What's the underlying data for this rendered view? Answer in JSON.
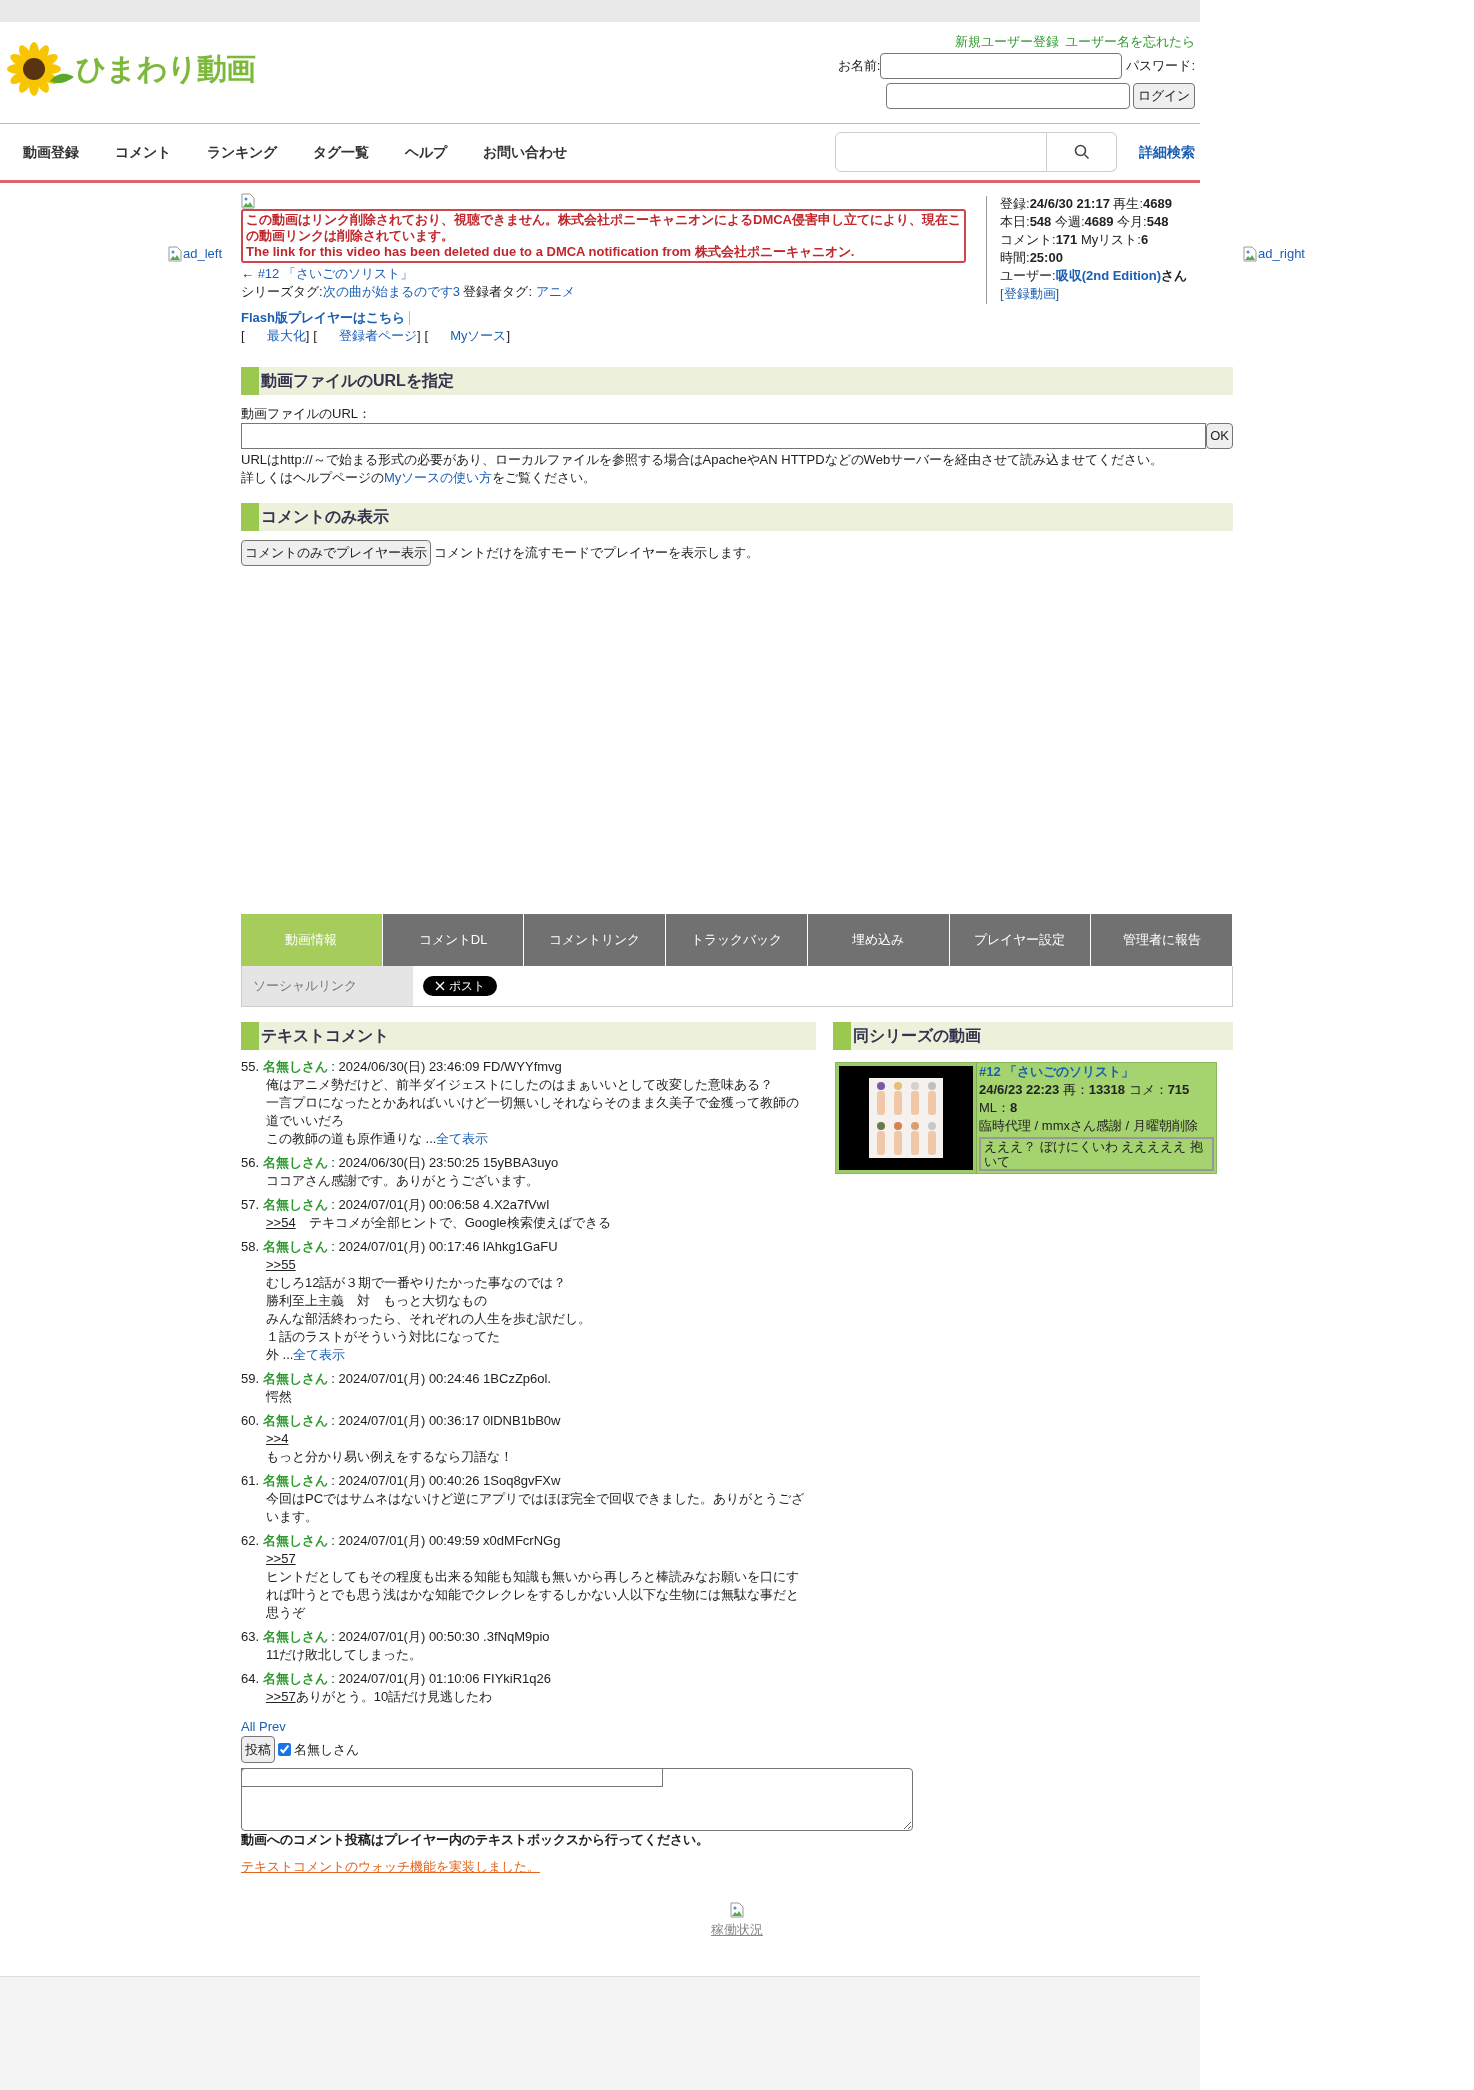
{
  "header": {
    "logo_text": "ひまわり動画",
    "account_links": [
      "新規ユーザー登録",
      "ユーザー名を忘れたら"
    ],
    "name_label": "お名前:",
    "password_label": "パスワード:",
    "login_button": "ログイン"
  },
  "nav": {
    "items": [
      "動画登録",
      "コメント",
      "ランキング",
      "タグ一覧",
      "ヘルプ",
      "お問い合わせ"
    ],
    "advanced_search": "詳細検索"
  },
  "ads": {
    "left": "ad_left",
    "right": "ad_right"
  },
  "notice": {
    "message_ja": "この動画はリンク削除されており、視聴できません。株式会社ポニーキャニオンによるDMCA侵害申し立てにより、現在この動画リンクは削除されています。",
    "message_en": "The link for this video has been deleted due to a DMCA notification from 株式会社ポニーキャニオン."
  },
  "prev_episode": {
    "arrow": "←",
    "title": "#12 「さいごのソリスト」"
  },
  "tags": {
    "series_label": "シリーズタグ:",
    "series_tag": "次の曲が始まるのです3",
    "user_label": "登録者タグ:",
    "user_tag": "アニメ"
  },
  "flash_link": "Flash版プレイヤーはこちら",
  "player_links": {
    "open": "[",
    "close": "]",
    "items": [
      "最大化",
      "登録者ページ",
      "Myソース"
    ]
  },
  "stats": {
    "lines": [
      "登録:**24/6/30 21:17** 再生:**4689**",
      "本日:**548** 今週:**4689** 今月:**548**",
      "コメント:**171** Myリスト:**6**",
      "時間:**25:00**"
    ],
    "user_label": "ユーザー:",
    "user_name": "吸収(2nd Edition)",
    "user_suffix": "さん",
    "user_link_open": "[",
    "user_link": "登録動画",
    "user_link_close": "]"
  },
  "url_section": {
    "title": "動画ファイルのURLを指定",
    "field_label": "動画ファイルのURL：",
    "ok_button": "OK",
    "help_line": "URLはhttp://～で始まる形式の必要があり、ローカルファイルを参照する場合はApacheやAN HTTPDなどのWebサーバーを経由させて読み込ませてください。",
    "help_prefix": "詳しくはヘルプページの",
    "help_link": "Myソースの使い方",
    "help_suffix": "をご覧ください。"
  },
  "comment_only_section": {
    "title": "コメントのみ表示",
    "button": "コメントのみでプレイヤー表示",
    "description": "コメントだけを流すモードでプレイヤーを表示します。"
  },
  "tabs": [
    {
      "label": "動画情報",
      "selected": true
    },
    {
      "label": "コメントDL",
      "selected": false
    },
    {
      "label": "コメントリンク",
      "selected": false
    },
    {
      "label": "トラックバック",
      "selected": false
    },
    {
      "label": "埋め込み",
      "selected": false
    },
    {
      "label": "プレイヤー設定",
      "selected": false
    },
    {
      "label": "管理者に報告",
      "selected": false
    }
  ],
  "social": {
    "label": "ソーシャルリンク",
    "post_button": "ポスト"
  },
  "text_comments": {
    "title": "テキストコメント",
    "items": [
      {
        "number": "55.",
        "name": "名無しさん",
        "meta": ": 2024/06/30(日) 23:46:09 FD/WYYfmvg",
        "lines": [
          {
            "text": "俺はアニメ勢だけど、前半ダイジェストにしたのはまぁいいとして改変した意味ある？"
          },
          {
            "text": "一言プロになったとかあればいいけど一切無いしそれならそのまま久美子で金獲って教師の道でいいだろ"
          },
          {
            "text": "この教師の道も原作通りな ...",
            "more": "全て表示"
          }
        ]
      },
      {
        "number": "56.",
        "name": "名無しさん",
        "meta": ": 2024/06/30(日) 23:50:25 15yBBA3uyo",
        "lines": [
          {
            "text": "ココアさん感謝です。ありがとうございます。"
          }
        ]
      },
      {
        "number": "57.",
        "name": "名無しさん",
        "meta": ": 2024/07/01(月) 00:06:58 4.X2a7fVwI",
        "lines": [
          {
            "reply": ">>54",
            "text": "　テキコメが全部ヒントで、Google検索使えばできる"
          }
        ]
      },
      {
        "number": "58.",
        "name": "名無しさん",
        "meta": ": 2024/07/01(月) 00:17:46 lAhkg1GaFU",
        "lines": [
          {
            "reply": ">>55"
          },
          {
            "text": "むしろ12話が３期で一番やりたかった事なのでは？"
          },
          {
            "text": "勝利至上主義　対　もっと大切なもの"
          },
          {
            "text": "みんな部活終わったら、それぞれの人生を歩む訳だし。"
          },
          {
            "text": "１話のラストがそういう対比になってた"
          },
          {
            "text": "外 ...",
            "more": "全て表示"
          }
        ]
      },
      {
        "number": "59.",
        "name": "名無しさん",
        "meta": ": 2024/07/01(月) 00:24:46 1BCzZp6ol.",
        "lines": [
          {
            "text": "愕然"
          }
        ]
      },
      {
        "number": "60.",
        "name": "名無しさん",
        "meta": ": 2024/07/01(月) 00:36:17 0lDNB1bB0w",
        "lines": [
          {
            "reply": ">>4"
          },
          {
            "text": "もっと分かり易い例えをするなら刀語な！"
          }
        ]
      },
      {
        "number": "61.",
        "name": "名無しさん",
        "meta": ": 2024/07/01(月) 00:40:26 1Soq8gvFXw",
        "lines": [
          {
            "text": "今回はPCではサムネはないけど逆にアプリではほぼ完全で回収できました。ありがとうございます。"
          }
        ]
      },
      {
        "number": "62.",
        "name": "名無しさん",
        "meta": ": 2024/07/01(月) 00:49:59 x0dMFcrNGg",
        "lines": [
          {
            "reply": ">>57"
          },
          {
            "text": "ヒントだとしてもその程度も出来る知能も知識も無いから再しろと棒読みなお願いを口にすれば叶うとでも思う浅はかな知能でクレクレをするしかない人以下な生物には無駄な事だと思うぞ"
          }
        ]
      },
      {
        "number": "63.",
        "name": "名無しさん",
        "meta": ": 2024/07/01(月) 00:50:30 .3fNqM9pio",
        "lines": [
          {
            "text": "11だけ敗北してしまった。"
          }
        ]
      },
      {
        "number": "64.",
        "name": "名無しさん",
        "meta": ": 2024/07/01(月) 01:10:06 FIYkiR1q26",
        "lines": [
          {
            "reply": ">>57",
            "text": "ありがとう。10話だけ見逃したわ"
          }
        ]
      }
    ]
  },
  "series": {
    "title": "同シリーズの動画",
    "video": {
      "kind": "picture",
      "title": "#12 「さいごのソリスト」",
      "stats": "**24/6/23 22:23** 再：**13318** コメ：**715** ML：**8**",
      "description": "臨時代理 / mmxさん感謝 / 月曜朝削除",
      "latest_comment": "えええ？ ぼけにくいわ えええええ 抱いて"
    }
  },
  "post_form": {
    "all_prev": "All Prev",
    "post_button": "投稿",
    "anonymous": {
      "label": "名無しさん",
      "checked": true
    },
    "note": "動画へのコメント投稿はプレイヤー内のテキストボックスから行ってください。",
    "watch_link": "テキストコメントのウォッチ機能を実装しました。"
  },
  "footer": {
    "status_link": "稼働状況"
  }
}
